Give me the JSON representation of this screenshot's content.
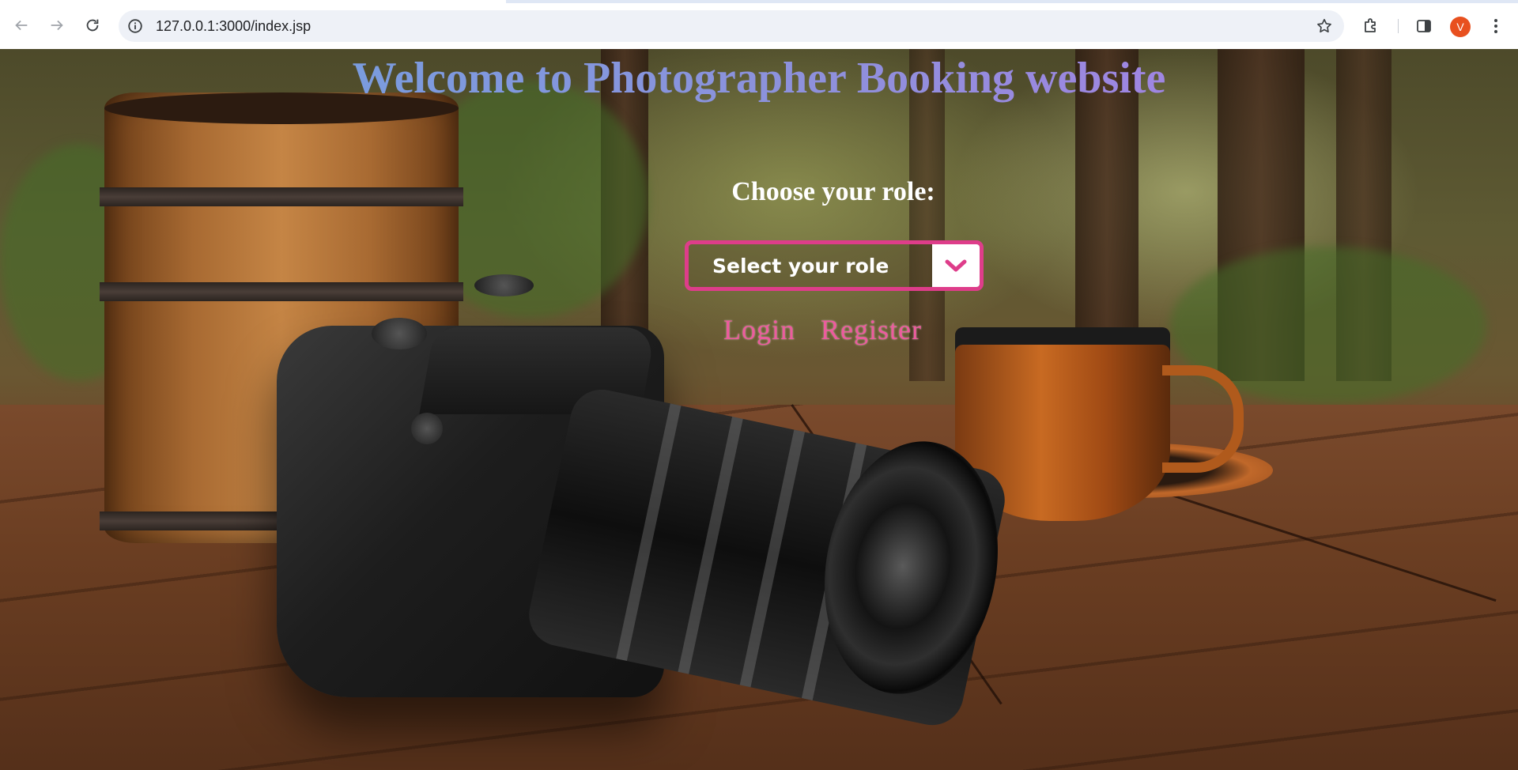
{
  "browser": {
    "url": "127.0.0.1:3000/index.jsp",
    "profile_initial": "V",
    "icons": {
      "back": "arrow-left-icon",
      "forward": "arrow-right-icon",
      "reload": "reload-icon",
      "site_info": "info-icon",
      "bookmark": "star-icon",
      "extensions": "puzzle-icon",
      "side_panel": "side-panel-icon",
      "menu": "kebab-menu-icon"
    },
    "colors": {
      "avatar": "#e8501f",
      "omnibox_bg": "#eef1f7"
    }
  },
  "page": {
    "title": "Welcome to Photographer Booking website",
    "role_heading": "Choose your role:",
    "role_select": {
      "selected": "Select your role",
      "arrow_icon": "chevron-down-icon"
    },
    "links": {
      "login": "Login",
      "register": "Register"
    },
    "colors": {
      "title_gradient_start": "#6ba4e0",
      "title_gradient_end": "#b07ae8",
      "accent_pink": "#de3d8a",
      "link_pink": "#ee5a9e"
    }
  }
}
